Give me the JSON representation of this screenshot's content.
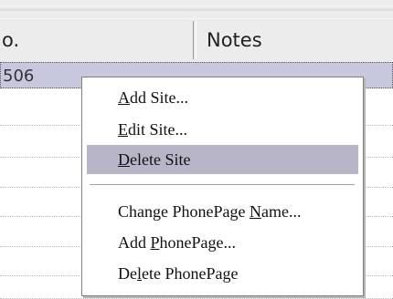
{
  "table": {
    "columns": [
      "o.",
      "Notes"
    ],
    "selected_row_text": "506"
  },
  "context_menu": {
    "items": [
      {
        "pre": "",
        "accel": "A",
        "post": "dd Site..."
      },
      {
        "pre": "",
        "accel": "E",
        "post": "dit Site..."
      },
      {
        "pre": "",
        "accel": "D",
        "post": "elete Site",
        "highlighted": true
      },
      {
        "pre": "Change PhonePage ",
        "accel": "N",
        "post": "ame..."
      },
      {
        "pre": "Add ",
        "accel": "P",
        "post": "honePage..."
      },
      {
        "pre": "De",
        "accel": "l",
        "post": "ete PhonePage"
      }
    ]
  }
}
